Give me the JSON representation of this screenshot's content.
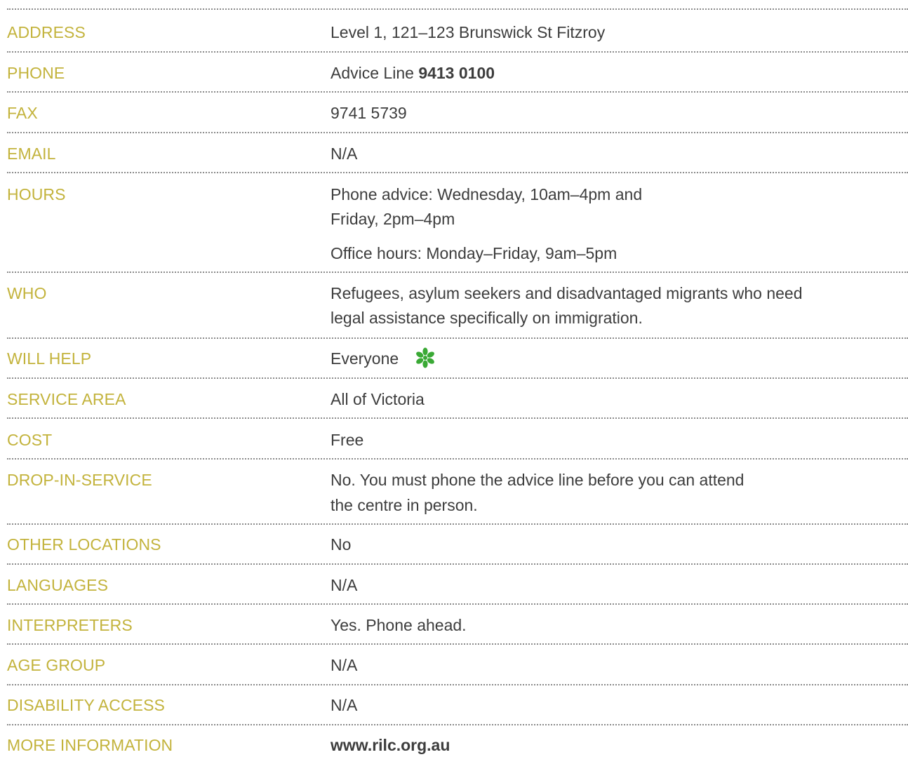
{
  "rows": {
    "address": {
      "label": "ADDRESS",
      "value": "Level 1, 121–123 Brunswick St Fitzroy"
    },
    "phone": {
      "label": "PHONE",
      "value_prefix": "Advice Line ",
      "value_bold": "9413 0100"
    },
    "fax": {
      "label": "FAX",
      "value": "9741 5739"
    },
    "email": {
      "label": "EMAIL",
      "value": "N/A"
    },
    "hours": {
      "label": "HOURS",
      "line1": "Phone advice: Wednesday, 10am–4pm and",
      "line2": "Friday, 2pm–4pm",
      "line3": "Office hours: Monday–Friday, 9am–5pm"
    },
    "who": {
      "label": "WHO",
      "line1": "Refugees, asylum seekers and disadvantaged migrants who need",
      "line2": "legal assistance specifically on immigration."
    },
    "will_help": {
      "label": "WILL HELP",
      "value": "Everyone",
      "icon": "flower-icon",
      "icon_color": "#3aa935"
    },
    "service_area": {
      "label": "SERVICE AREA",
      "value": "All of Victoria"
    },
    "cost": {
      "label": "COST",
      "value": "Free"
    },
    "drop_in": {
      "label": "DROP-IN-SERVICE",
      "line1": "No. You must phone the advice line before you can attend",
      "line2": "the centre in person."
    },
    "other_locations": {
      "label": "OTHER LOCATIONS",
      "value": "No"
    },
    "languages": {
      "label": "LANGUAGES",
      "value": "N/A"
    },
    "interpreters": {
      "label": "INTERPRETERS",
      "value": "Yes. Phone ahead."
    },
    "age_group": {
      "label": "AGE GROUP",
      "value": "N/A"
    },
    "disability_access": {
      "label": "DISABILITY ACCESS",
      "value": "N/A"
    },
    "more_information": {
      "label": "MORE INFORMATION",
      "value": "www.rilc.org.au"
    }
  },
  "colors": {
    "label": "#c3b33c",
    "value": "#3d3d3d",
    "rule": "#8a8a8a"
  }
}
